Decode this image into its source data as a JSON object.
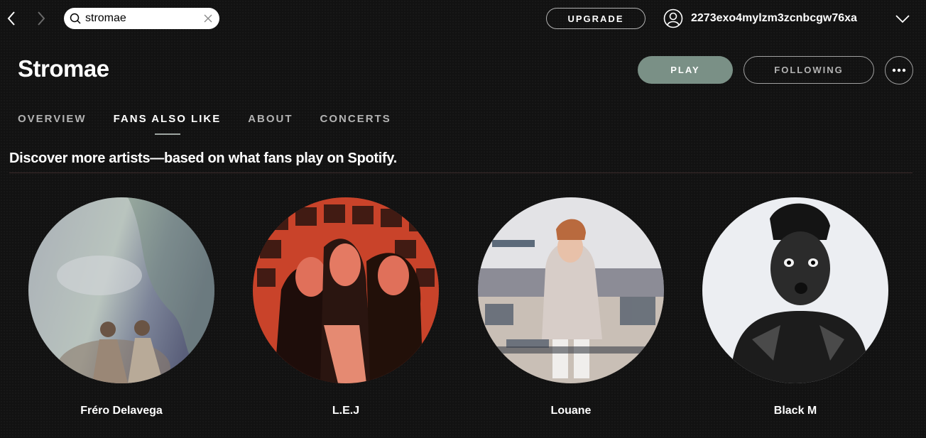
{
  "search": {
    "value": "stromae",
    "placeholder": "Search"
  },
  "topbar": {
    "upgrade_label": "UPGRADE",
    "username": "2273exo4mylzm3zcnbcgw76xa"
  },
  "artist": {
    "name": "Stromae",
    "play_label": "PLAY",
    "follow_label": "FOLLOWING"
  },
  "tabs": [
    {
      "label": "OVERVIEW",
      "active": false
    },
    {
      "label": "FANS ALSO LIKE",
      "active": true
    },
    {
      "label": "ABOUT",
      "active": false
    },
    {
      "label": "CONCERTS",
      "active": false
    }
  ],
  "section": {
    "subtitle": "Discover more artists—based on what fans play on Spotify."
  },
  "related_artists": [
    {
      "name": "Fréro Delavega",
      "icon": "sky-photo"
    },
    {
      "name": "L.E.J",
      "icon": "red-tinted-photo"
    },
    {
      "name": "Louane",
      "icon": "beach-photo"
    },
    {
      "name": "Black M",
      "icon": "bw-portrait-photo"
    }
  ],
  "colors": {
    "background": "#121212",
    "play_button": "#7a9086",
    "accent_text": "#b3b3b3"
  }
}
